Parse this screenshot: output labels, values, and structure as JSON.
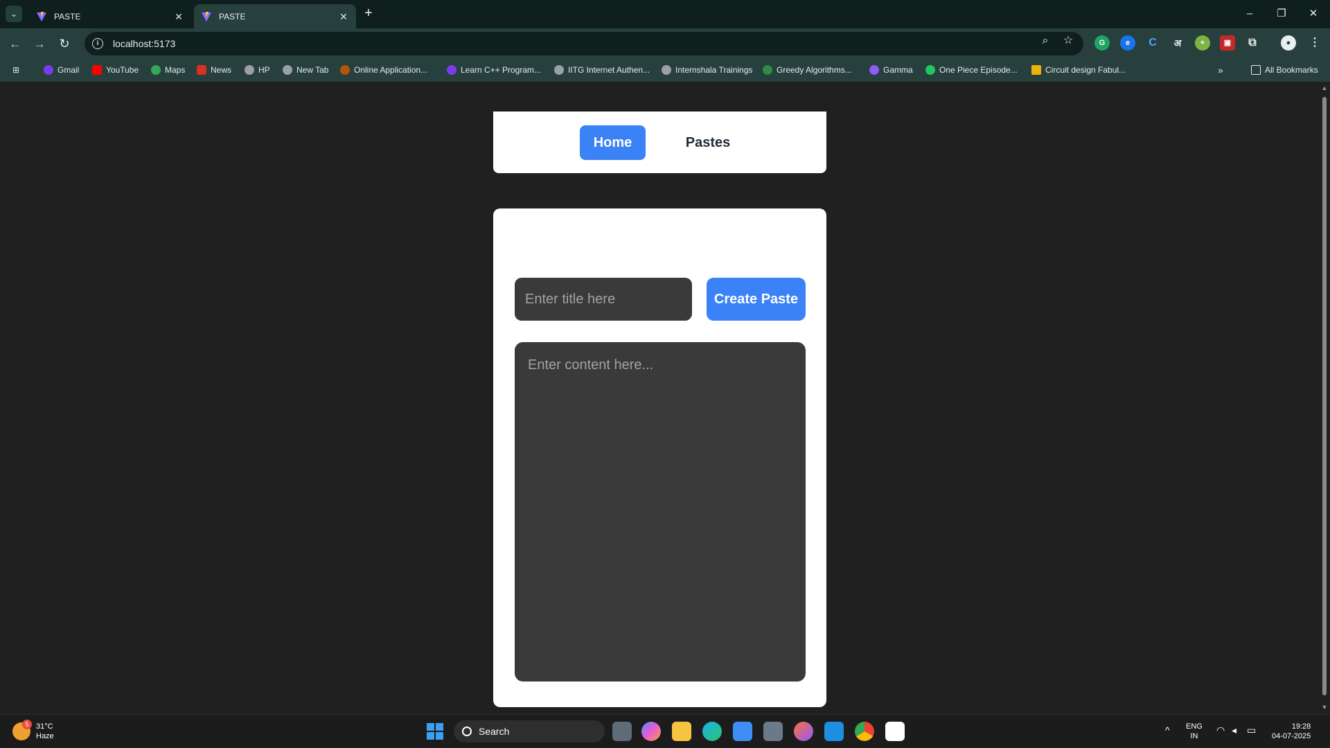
{
  "browser": {
    "tabs": [
      {
        "title": "PASTE",
        "active": false
      },
      {
        "title": "PASTE",
        "active": true
      }
    ],
    "url": "localhost:5173",
    "bookmarks": [
      {
        "label": "Gmail",
        "color": "#7c3aed"
      },
      {
        "label": "YouTube",
        "color": "#ff0000"
      },
      {
        "label": "Maps",
        "color": "#34a853"
      },
      {
        "label": "News",
        "color": "#d93025"
      },
      {
        "label": "HP",
        "color": "#9aa0a6"
      },
      {
        "label": "New Tab",
        "color": "#9aa0a6"
      },
      {
        "label": "Online Application...",
        "color": "#b45309"
      },
      {
        "label": "Learn C++ Program...",
        "color": "#7c3aed"
      },
      {
        "label": "IITG Internet Authen...",
        "color": "#9aa0a6"
      },
      {
        "label": "Internshala Trainings",
        "color": "#9aa0a6"
      },
      {
        "label": "Greedy Algorithms...",
        "color": "#2f8d46"
      },
      {
        "label": "Gamma",
        "color": "#8b5cf6"
      },
      {
        "label": "One Piece Episode...",
        "color": "#22c55e"
      },
      {
        "label": "Circuit design Fabul...",
        "color": "#eab308"
      }
    ],
    "all_bookmarks": "All Bookmarks"
  },
  "app": {
    "nav": {
      "home": "Home",
      "pastes": "Pastes"
    },
    "form": {
      "title_placeholder": "Enter title here",
      "create_button": "Create Paste",
      "content_placeholder": "Enter content here..."
    },
    "accent_color": "#3b82f6"
  },
  "taskbar": {
    "weather": {
      "temp": "31°C",
      "condition": "Haze",
      "badge": "5"
    },
    "search": "Search",
    "lang": "ENG",
    "region": "IN",
    "time": "19:28",
    "date": "04-07-2025"
  }
}
